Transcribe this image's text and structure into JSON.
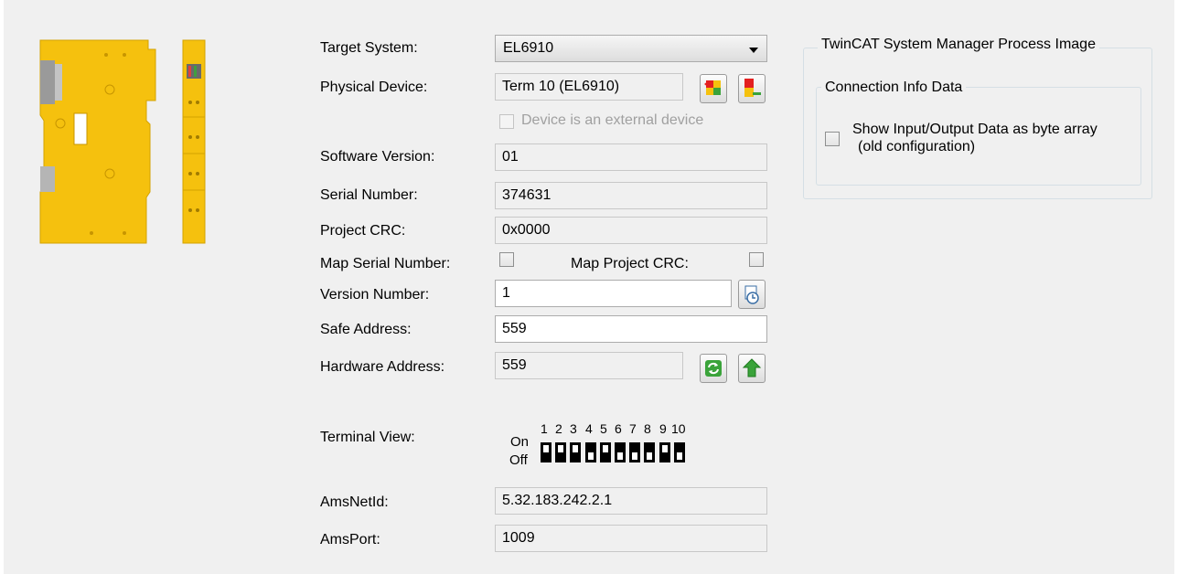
{
  "form": {
    "target_system_label": "Target System:",
    "target_system_value": "EL6910",
    "physical_device_label": "Physical Device:",
    "physical_device_value": "Term 10 (EL6910)",
    "external_device_label": "Device is an external device",
    "software_version_label": "Software Version:",
    "software_version_value": "01",
    "serial_number_label": "Serial Number:",
    "serial_number_value": "374631",
    "project_crc_label": "Project CRC:",
    "project_crc_value": "0x0000",
    "map_serial_label": "Map Serial Number:",
    "map_crc_label": "Map Project CRC:",
    "version_number_label": "Version Number:",
    "version_number_value": "1",
    "safe_address_label": "Safe Address:",
    "safe_address_value": "559",
    "hardware_address_label": "Hardware Address:",
    "hardware_address_value": "559",
    "terminal_view_label": "Terminal View:",
    "on_label": "On",
    "off_label": "Off",
    "dip_numbers": [
      "1",
      "2",
      "3",
      "4",
      "5",
      "6",
      "7",
      "8",
      "9",
      "10"
    ],
    "dip_states": [
      "on",
      "on",
      "on",
      "off",
      "on",
      "off",
      "off",
      "off",
      "on",
      "off"
    ],
    "amsnetid_label": "AmsNetId:",
    "amsnetid_value": "5.32.183.242.2.1",
    "amsport_label": "AmsPort:",
    "amsport_value": "1009"
  },
  "process_image": {
    "group_title": "TwinCAT System Manager Process Image",
    "subgroup_title": "Connection Info Data",
    "byte_array_label": "Show Input/Output Data as byte array",
    "byte_array_sublabel": "(old configuration)"
  },
  "colors": {
    "terminal_yellow": "#f5c10e",
    "panel_bg": "#f0f0f0",
    "icon_green": "#3aa33a",
    "icon_red": "#e32020"
  }
}
